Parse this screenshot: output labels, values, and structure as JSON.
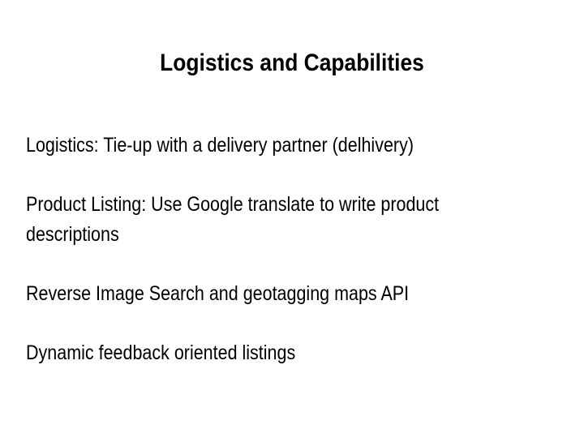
{
  "slide": {
    "title": "Logistics and Capabilities",
    "paragraphs": [
      "Logistics: Tie-up with a delivery partner (delhivery)",
      "Product Listing: Use Google translate to write product descriptions",
      "Reverse Image Search and geotagging maps API",
      "Dynamic feedback oriented listings"
    ]
  }
}
